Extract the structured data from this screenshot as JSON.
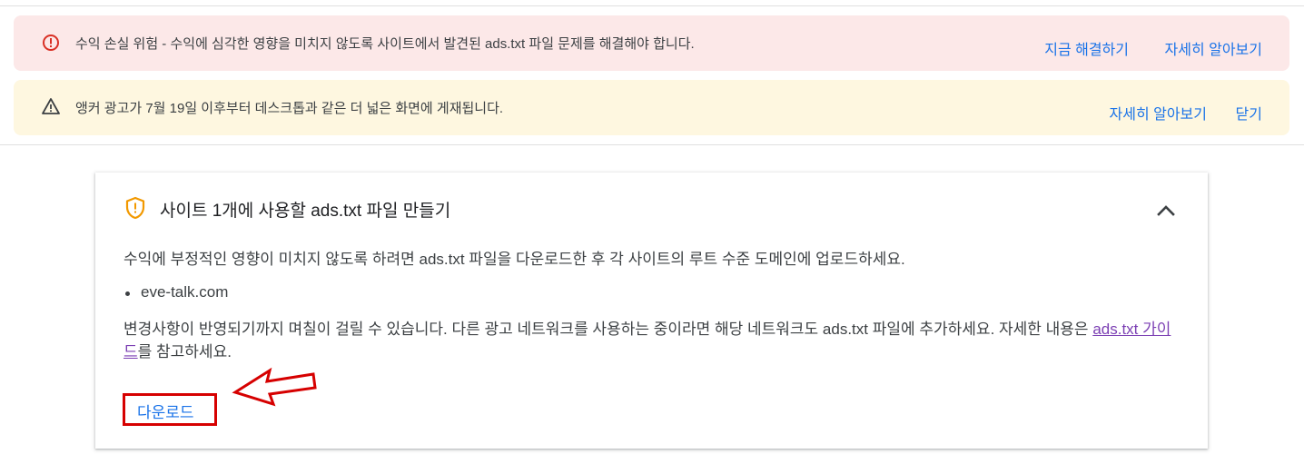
{
  "alerts": {
    "error": {
      "icon": "error-circle-icon",
      "text": "수익 손실 위험 - 수익에 심각한 영향을 미치지 않도록 사이트에서 발견된 ads.txt 파일 문제를 해결해야 합니다.",
      "fix_label": "지금 해결하기",
      "learn_label": "자세히 알아보기",
      "color": "#d93025"
    },
    "warning": {
      "icon": "warning-triangle-icon",
      "text": "앵커 광고가 7월 19일 이후부터 데스크톱과 같은 더 넓은 화면에 게재됩니다.",
      "learn_label": "자세히 알아보기",
      "close_label": "닫기"
    }
  },
  "card": {
    "icon": "shield-alert-icon",
    "title": "사이트 1개에 사용할 ads.txt 파일 만들기",
    "description": "수익에 부정적인 영향이 미치지 않도록 하려면 ads.txt 파일을 다운로드한 후 각 사이트의 루트 수준 도메인에 업로드하세요.",
    "sites": [
      "eve-talk.com"
    ],
    "note_prefix": "변경사항이 반영되기까지 며칠이 걸릴 수 있습니다. 다른 광고 네트워크를 사용하는 중이라면 해당 네트워크도 ads.txt 파일에 추가하세요. 자세한 내용은 ",
    "note_link": "ads.txt 가이드",
    "note_suffix": "를 참고하세요.",
    "download_label": "다운로드",
    "accent_color": "#f29900",
    "highlight_color": "#d60000",
    "link_color": "#1a73e8"
  }
}
